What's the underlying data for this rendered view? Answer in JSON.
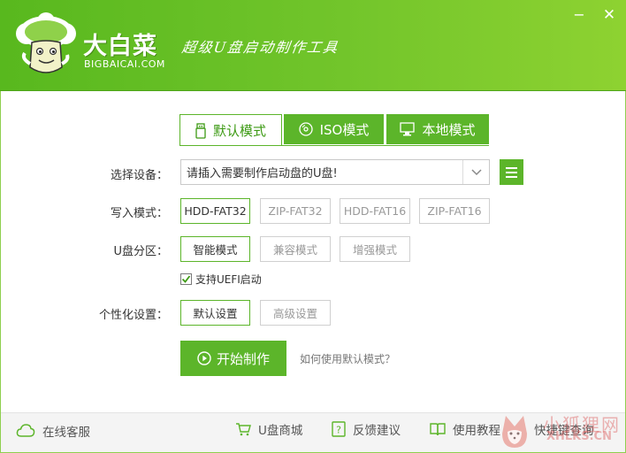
{
  "app": {
    "logo_text": "大白菜",
    "logo_sub": "BIGBAICAI.COM",
    "slogan": "超级U盘启动制作工具",
    "min_symbol": "−",
    "close_symbol": "✕"
  },
  "tabs": [
    {
      "label": "默认模式",
      "icon": "usb-icon",
      "selected": true
    },
    {
      "label": "ISO模式",
      "icon": "disc-icon",
      "selected": false
    },
    {
      "label": "本地模式",
      "icon": "monitor-icon",
      "selected": false
    }
  ],
  "device": {
    "label": "选择设备：",
    "value": "请插入需要制作启动盘的U盘!"
  },
  "write_mode": {
    "label": "写入模式：",
    "options": [
      "HDD-FAT32",
      "ZIP-FAT32",
      "HDD-FAT16",
      "ZIP-FAT16"
    ],
    "selected": "HDD-FAT32"
  },
  "partition": {
    "label": "U盘分区：",
    "options": [
      "智能模式",
      "兼容模式",
      "增强模式"
    ],
    "selected": "智能模式"
  },
  "uefi": {
    "label": "支持UEFI启动",
    "checked": true
  },
  "personalize": {
    "label": "个性化设置：",
    "options": [
      "默认设置",
      "高级设置"
    ],
    "selected": "默认设置"
  },
  "actions": {
    "start_label": "开始制作",
    "help_link": "如何使用默认模式？"
  },
  "footer": {
    "service": "在线客服",
    "shop": "U盘商城",
    "feedback": "反馈建议",
    "tutorial": "使用教程",
    "hotkey": "快捷键查询"
  },
  "watermark": {
    "line1": "小狐狸网",
    "line2": "XHLKS.CN"
  },
  "colors": {
    "brand_green": "#5cb52a",
    "header_start": "#58b81e",
    "header_end": "#8ed231"
  }
}
